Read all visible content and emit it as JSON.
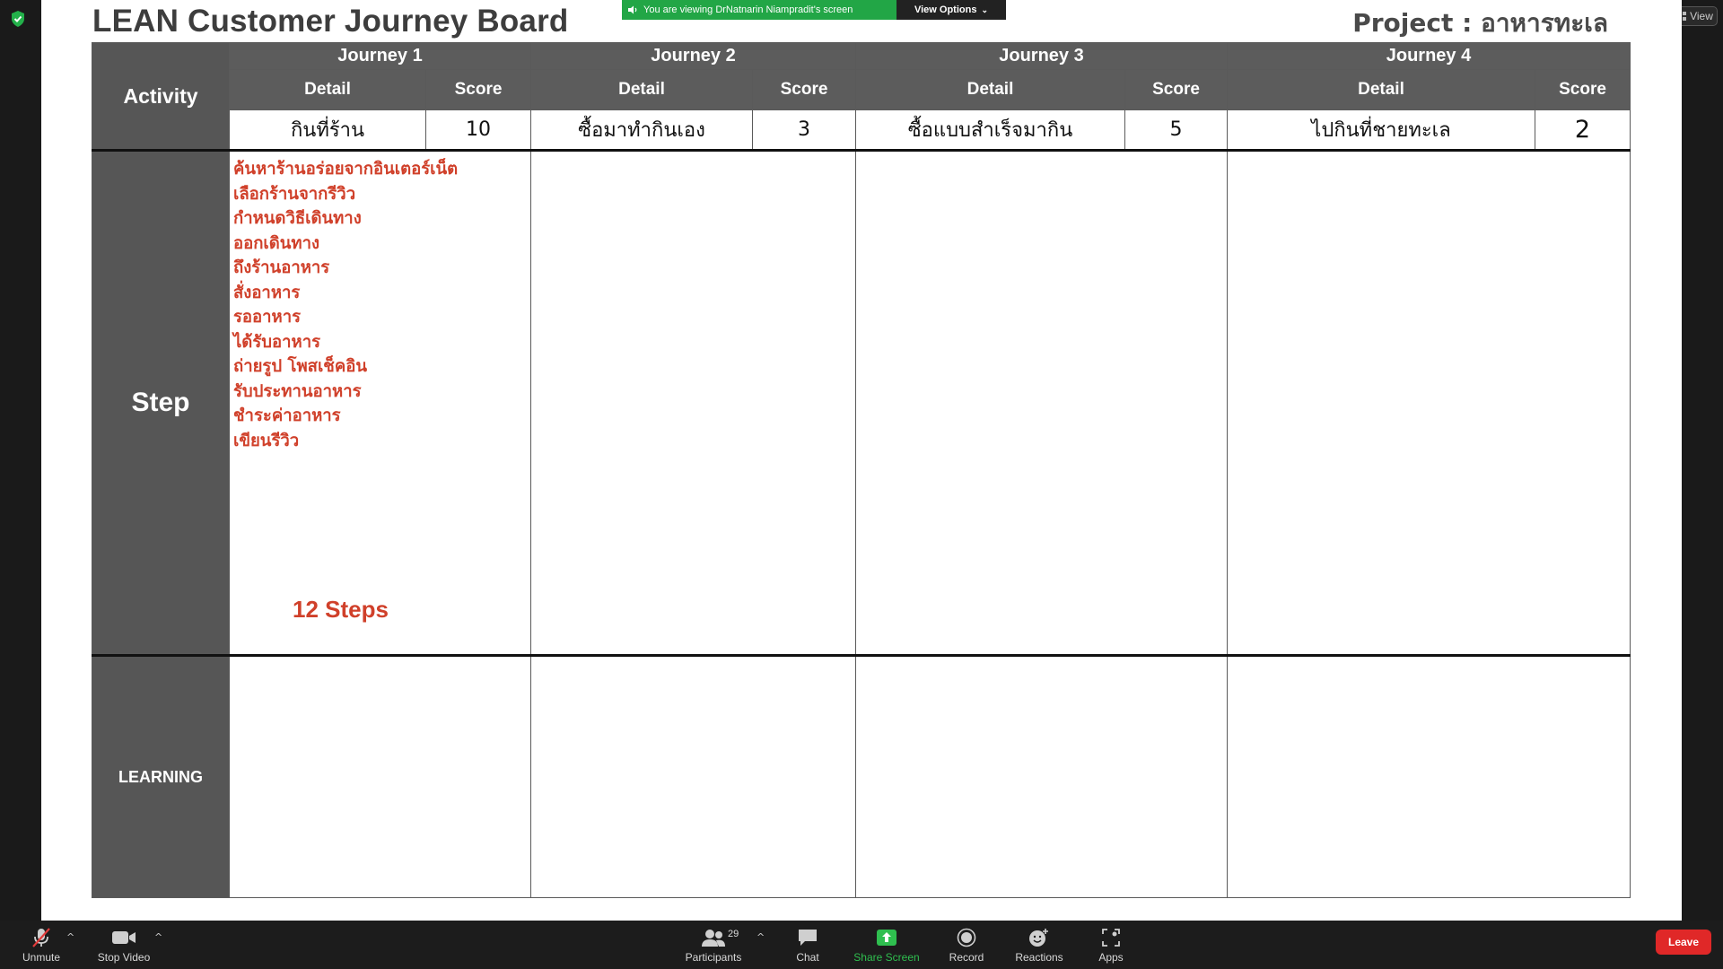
{
  "window": {
    "view_label": "View"
  },
  "share_banner": {
    "viewing_text": "You are viewing DrNatnarin Niampradit's screen",
    "view_options_label": "View Options"
  },
  "slide": {
    "title": "LEAN Customer Journey Board",
    "project_label": "Project : อาหารทะเล",
    "row_labels": {
      "activity": "Activity",
      "step": "Step",
      "learning": "LEARNING"
    },
    "journeys": [
      {
        "header": "Journey 1",
        "detail_label": "Detail",
        "score_label": "Score",
        "detail": "กินที่ร้าน",
        "score": "10"
      },
      {
        "header": "Journey 2",
        "detail_label": "Detail",
        "score_label": "Score",
        "detail": "ซื้อมาทำกินเอง",
        "score": "3"
      },
      {
        "header": "Journey 3",
        "detail_label": "Detail",
        "score_label": "Score",
        "detail": "ซื้อแบบสำเร็จมากิน",
        "score": "5"
      },
      {
        "header": "Journey 4",
        "detail_label": "Detail",
        "score_label": "Score",
        "detail": "ไปกินที่ชายทะเล",
        "score": "2"
      }
    ],
    "journey1_steps": [
      "ค้นหาร้านอร่อยจากอินเตอร์เน็ต",
      "เลือกร้านจากรีวิว",
      "กำหนดวิธีเดินทาง",
      "ออกเดินทาง",
      "ถึงร้านอาหาร",
      "สั่งอาหาร",
      "รออาหาร",
      "ได้รับอาหาร",
      "ถ่ายรูป โพสเช็คอิน",
      "รับประทานอาหาร",
      "ชำระค่าอาหาร",
      "เขียนรีวิว"
    ],
    "journey1_steps_total": "12 Steps"
  },
  "toolbar": {
    "unmute": "Unmute",
    "stop_video": "Stop Video",
    "participants": "Participants",
    "participants_count": "29",
    "chat": "Chat",
    "share_screen": "Share Screen",
    "record": "Record",
    "reactions": "Reactions",
    "apps": "Apps",
    "leave": "Leave"
  },
  "colors": {
    "header_gray": "#5c5c5c",
    "step_text_red": "#d0402a",
    "share_green": "#22a646",
    "leave_red": "#e02828"
  }
}
